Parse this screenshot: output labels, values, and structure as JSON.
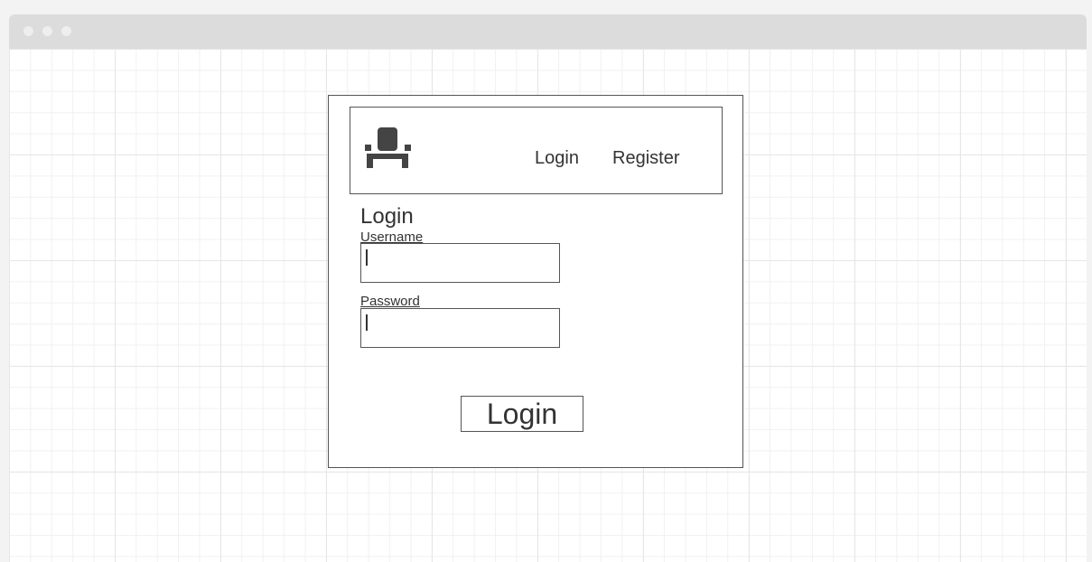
{
  "nav": {
    "logo_icon": "armchair-icon",
    "login_label": "Login",
    "register_label": "Register"
  },
  "form": {
    "heading": "Login",
    "username_label": "Username",
    "username_value": "",
    "password_label": "Password",
    "password_value": "",
    "submit_label": "Login"
  },
  "colors": {
    "stroke": "#555555",
    "text": "#333333",
    "icon": "#444444",
    "titlebar": "#dcdcdc"
  }
}
